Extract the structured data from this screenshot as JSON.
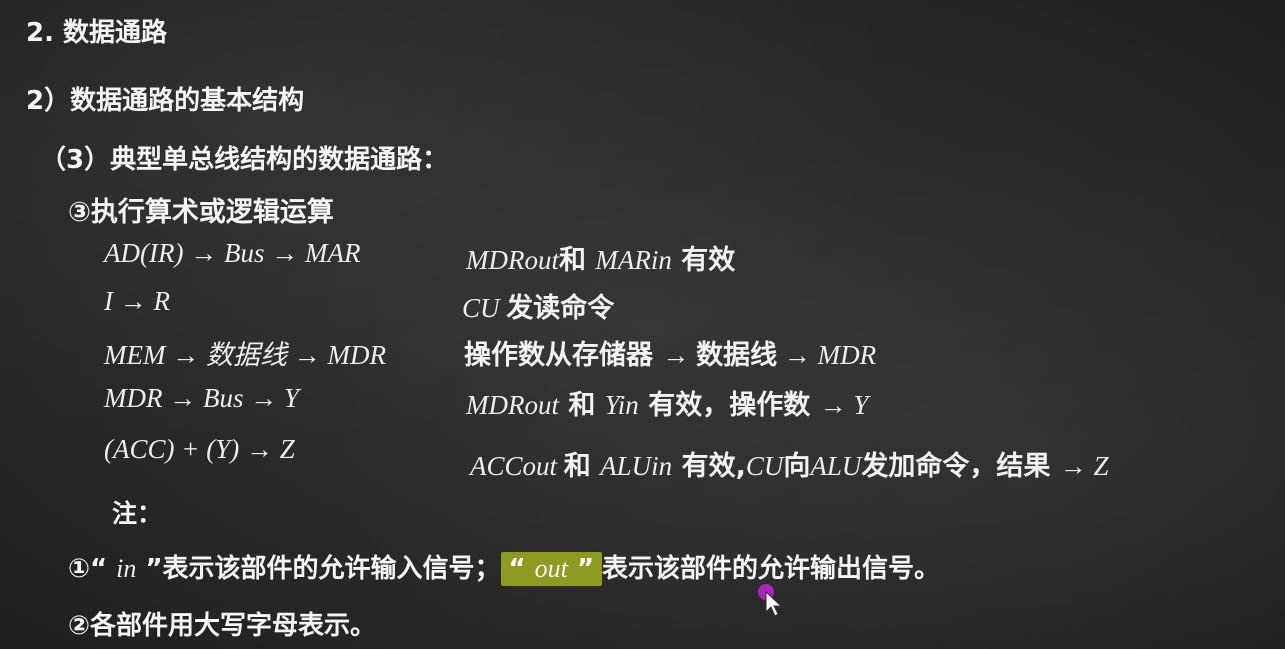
{
  "headings": {
    "h1": "2. 数据通路",
    "h2": "2）数据通路的基本结构",
    "h3": "（3）典型单总线结构的数据通路：",
    "h4": "③执行算术或逻辑运算"
  },
  "steps": [
    {
      "formula": "AD(IR) → Bus → MAR",
      "desc_parts": [
        {
          "t": "MDRout",
          "m": true
        },
        {
          "t": "和 ",
          "m": false
        },
        {
          "t": "MARin",
          "m": true
        },
        {
          "t": " 有效",
          "m": false
        }
      ]
    },
    {
      "formula": "I → R",
      "desc_parts": [
        {
          "t": "CU ",
          "m": true
        },
        {
          "t": " 发读命令",
          "m": false
        }
      ]
    },
    {
      "formula": "MEM → 数据线 → MDR",
      "desc_parts": [
        {
          "t": "操作数从存储器 ",
          "m": false
        },
        {
          "t": " → ",
          "m": true
        },
        {
          "t": "数据线",
          "m": false
        },
        {
          "t": " → MDR",
          "m": true
        }
      ]
    },
    {
      "formula": "MDR → Bus → Y",
      "desc_parts": [
        {
          "t": "MDRout",
          "m": true
        },
        {
          "t": " 和 ",
          "m": false
        },
        {
          "t": "Yin",
          "m": true
        },
        {
          "t": " 有效，操作数 ",
          "m": false
        },
        {
          "t": "→ Y",
          "m": true
        }
      ]
    },
    {
      "formula": "(ACC) + (Y) → Z",
      "desc_parts": [
        {
          "t": "ACCout ",
          "m": true
        },
        {
          "t": " 和 ",
          "m": false
        },
        {
          "t": "ALUin",
          "m": true
        },
        {
          "t": " 有效,",
          "m": false
        },
        {
          "t": "CU",
          "m": true
        },
        {
          "t": "向",
          "m": false
        },
        {
          "t": "ALU",
          "m": true
        },
        {
          "t": "发加命令，结果 ",
          "m": false
        },
        {
          "t": "→ Z",
          "m": true
        }
      ]
    }
  ],
  "note": {
    "label": "注：",
    "item1_prefix": "①“ ",
    "item1_in": "in",
    "item1_mid": " ”表示该部件的允许输入信号；",
    "item1_hl_open": "“ ",
    "item1_out": "out",
    "item1_hl_close": " ”",
    "item1_suffix": "表示该部件的允许输出信号。",
    "item2": "②各部件用大写字母表示。"
  },
  "colors": {
    "highlight": "#8e9a20",
    "cursor_dot": "#c026d3"
  }
}
